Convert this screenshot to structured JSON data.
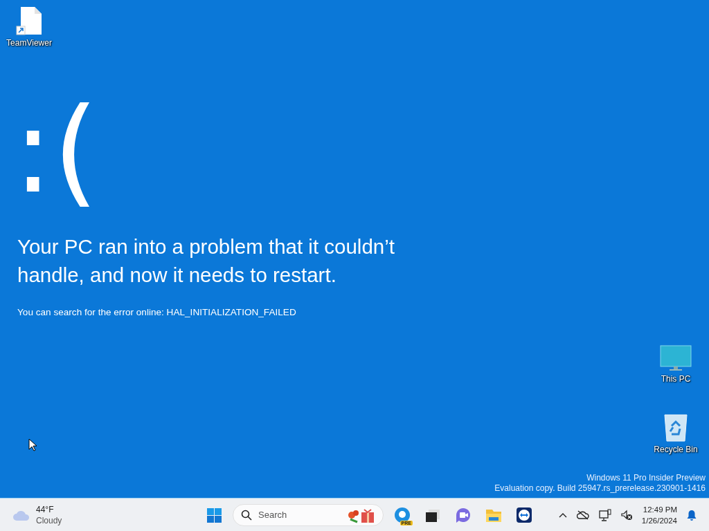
{
  "desktop_icons": [
    {
      "label": "TeamViewer",
      "kind": "shortcut"
    },
    {
      "label": "This PC",
      "kind": "computer"
    },
    {
      "label": "Recycle Bin",
      "kind": "recycle"
    }
  ],
  "crash_screen": {
    "emoticon": ":(",
    "message": "Your PC ran into a problem that it couldn’t handle, and now it needs to restart.",
    "detail": "You can search for the error online: HAL_INITIALIZATION_FAILED"
  },
  "build_info": [
    "Windows 11 Pro Insider Preview",
    "Evaluation copy. Build 25947.rs_prerelease.230901-1416"
  ],
  "taskbar": {
    "weather": {
      "temperature": "44°F",
      "condition": "Cloudy"
    },
    "search": {
      "placeholder": "Search"
    },
    "apps": [
      {
        "kind": "start"
      },
      {
        "kind": "search"
      },
      {
        "kind": "browser",
        "badge": "PRE"
      },
      {
        "kind": "desktops"
      },
      {
        "kind": "meet"
      },
      {
        "kind": "folder"
      },
      {
        "kind": "remote"
      }
    ],
    "clock": {
      "time": "12:49 PM",
      "date": "1/26/2024"
    }
  }
}
